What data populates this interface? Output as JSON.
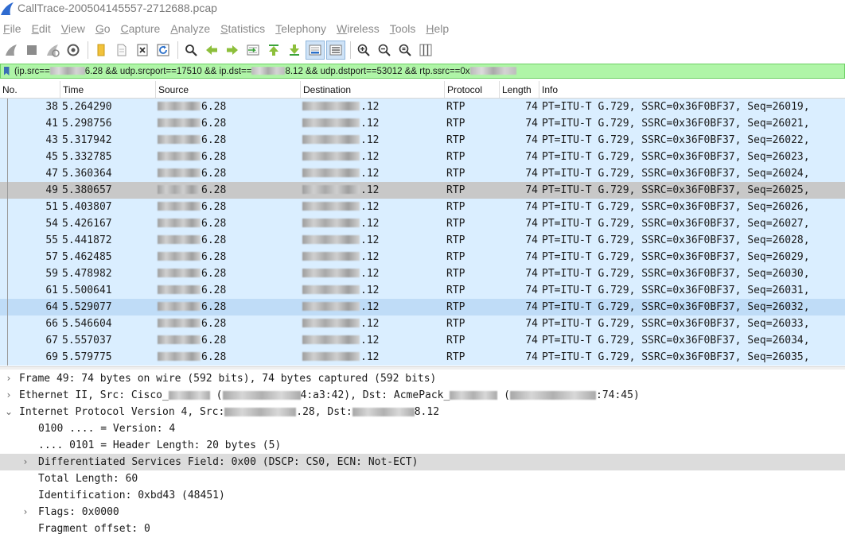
{
  "window": {
    "title": "CallTrace-200504145557-2712688.pcap"
  },
  "menu": [
    {
      "label": "File"
    },
    {
      "label": "Edit"
    },
    {
      "label": "View"
    },
    {
      "label": "Go"
    },
    {
      "label": "Capture"
    },
    {
      "label": "Analyze"
    },
    {
      "label": "Statistics"
    },
    {
      "label": "Telephony"
    },
    {
      "label": "Wireless"
    },
    {
      "label": "Tools"
    },
    {
      "label": "Help"
    }
  ],
  "toolbar": {
    "icons": [
      "shark-fin-start-icon",
      "stop-icon",
      "restart-icon",
      "options-gear-icon",
      "open-file-icon",
      "file-icon",
      "close-file-icon",
      "reload-icon",
      "find-icon",
      "back-arrow-icon",
      "forward-arrow-icon",
      "go-to-packet-icon",
      "first-packet-icon",
      "last-packet-icon",
      "autoscroll-icon",
      "colorize-icon",
      "zoom-in-icon",
      "zoom-out-icon",
      "normal-size-icon",
      "resize-columns-icon"
    ],
    "colors": {
      "green": "#3aa33a",
      "blue": "#2a6fc9",
      "gray": "#707070"
    }
  },
  "filter": {
    "text_parts": [
      "(ip.src==",
      "6.28 && udp.srcport==17510 && ip.dst==",
      "8.12 && udp.dstport==53012 && rtp.ssrc==0x"
    ],
    "background": "#aff5a7"
  },
  "packet_list": {
    "columns": [
      "No.",
      "Time",
      "Source",
      "Destination",
      "Protocol",
      "Length",
      "Info"
    ],
    "source_suffix": "6.28",
    "destination_suffix": ".12",
    "rows": [
      {
        "no": "38",
        "time": "5.264290",
        "protocol": "RTP",
        "length": "74",
        "info": "PT=ITU-T G.729, SSRC=0x36F0BF37, Seq=26019,"
      },
      {
        "no": "41",
        "time": "5.298756",
        "protocol": "RTP",
        "length": "74",
        "info": "PT=ITU-T G.729, SSRC=0x36F0BF37, Seq=26021,"
      },
      {
        "no": "43",
        "time": "5.317942",
        "protocol": "RTP",
        "length": "74",
        "info": "PT=ITU-T G.729, SSRC=0x36F0BF37, Seq=26022,"
      },
      {
        "no": "45",
        "time": "5.332785",
        "protocol": "RTP",
        "length": "74",
        "info": "PT=ITU-T G.729, SSRC=0x36F0BF37, Seq=26023,"
      },
      {
        "no": "47",
        "time": "5.360364",
        "protocol": "RTP",
        "length": "74",
        "info": "PT=ITU-T G.729, SSRC=0x36F0BF37, Seq=26024,"
      },
      {
        "no": "49",
        "time": "5.380657",
        "protocol": "RTP",
        "length": "74",
        "info": "PT=ITU-T G.729, SSRC=0x36F0BF37, Seq=26025,",
        "state": "selected"
      },
      {
        "no": "51",
        "time": "5.403807",
        "protocol": "RTP",
        "length": "74",
        "info": "PT=ITU-T G.729, SSRC=0x36F0BF37, Seq=26026,"
      },
      {
        "no": "54",
        "time": "5.426167",
        "protocol": "RTP",
        "length": "74",
        "info": "PT=ITU-T G.729, SSRC=0x36F0BF37, Seq=26027,"
      },
      {
        "no": "55",
        "time": "5.441872",
        "protocol": "RTP",
        "length": "74",
        "info": "PT=ITU-T G.729, SSRC=0x36F0BF37, Seq=26028,"
      },
      {
        "no": "57",
        "time": "5.462485",
        "protocol": "RTP",
        "length": "74",
        "info": "PT=ITU-T G.729, SSRC=0x36F0BF37, Seq=26029,"
      },
      {
        "no": "59",
        "time": "5.478982",
        "protocol": "RTP",
        "length": "74",
        "info": "PT=ITU-T G.729, SSRC=0x36F0BF37, Seq=26030,"
      },
      {
        "no": "61",
        "time": "5.500641",
        "protocol": "RTP",
        "length": "74",
        "info": "PT=ITU-T G.729, SSRC=0x36F0BF37, Seq=26031,"
      },
      {
        "no": "64",
        "time": "5.529077",
        "protocol": "RTP",
        "length": "74",
        "info": "PT=ITU-T G.729, SSRC=0x36F0BF37, Seq=26032,",
        "state": "hover"
      },
      {
        "no": "66",
        "time": "5.546604",
        "protocol": "RTP",
        "length": "74",
        "info": "PT=ITU-T G.729, SSRC=0x36F0BF37, Seq=26033,"
      },
      {
        "no": "67",
        "time": "5.557037",
        "protocol": "RTP",
        "length": "74",
        "info": "PT=ITU-T G.729, SSRC=0x36F0BF37, Seq=26034,"
      },
      {
        "no": "69",
        "time": "5.579775",
        "protocol": "RTP",
        "length": "74",
        "info": "PT=ITU-T G.729, SSRC=0x36F0BF37, Seq=26035,"
      }
    ],
    "row_color": "#daeeff",
    "selected_color": "#c8c8c8",
    "hover_color": "#bfdcf7"
  },
  "details": {
    "frame": "Frame 49: 74 bytes on wire (592 bits), 74 bytes captured (592 bits)",
    "ethernet": {
      "prefix": "Ethernet II, Src: Cisco_",
      "mid": "4:a3:42), Dst: AcmePack_",
      "suffix": ":74:45)"
    },
    "ipv4": {
      "prefix": "Internet Protocol Version 4, Src: ",
      "mid": ".28, Dst: ",
      "suffix": "8.12"
    },
    "fields": [
      {
        "text": "0100 .... = Version: 4",
        "expandable": false
      },
      {
        "text": ".... 0101 = Header Length: 20 bytes (5)",
        "expandable": false
      },
      {
        "text": "Differentiated Services Field: 0x00 (DSCP: CS0, ECN: Not-ECT)",
        "expandable": true,
        "highlight": true
      },
      {
        "text": "Total Length: 60",
        "expandable": false
      },
      {
        "text": "Identification: 0xbd43 (48451)",
        "expandable": false
      },
      {
        "text": "Flags: 0x0000",
        "expandable": true
      },
      {
        "text": "Fragment offset: 0",
        "expandable": false
      }
    ]
  }
}
